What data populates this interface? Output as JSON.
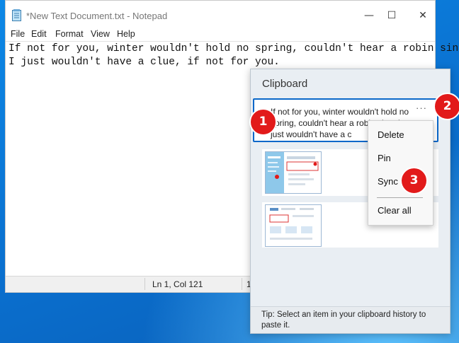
{
  "notepad": {
    "title": "*New Text Document.txt - Notepad",
    "window_buttons": {
      "minimize": "—",
      "maximize": "☐",
      "close": "✕"
    },
    "menu": [
      "File",
      "Edit",
      "Format",
      "View",
      "Help"
    ],
    "content_lines": [
      "If not for you, winter wouldn't hold no spring, couldn't hear a robin sing.",
      "I just wouldn't have a clue, if not for you."
    ],
    "status": {
      "position": "Ln 1, Col 121",
      "zoom_partial": "10"
    }
  },
  "clipboard": {
    "title": "Clipboard",
    "items": [
      {
        "text": "If not for you, winter wouldn't hold no spring, couldn't hear a robin sing. I just wouldn't have a c",
        "more": "···"
      }
    ],
    "tip": "Tip: Select an item in your clipboard history to paste it."
  },
  "context_menu": {
    "items": [
      "Delete",
      "Pin",
      "Sync",
      "Clear all"
    ]
  },
  "badges": [
    "1",
    "2",
    "3"
  ],
  "colors": {
    "accent": "#0a67c9",
    "badge": "#e21a1a",
    "desktop": "#0a78d4"
  }
}
